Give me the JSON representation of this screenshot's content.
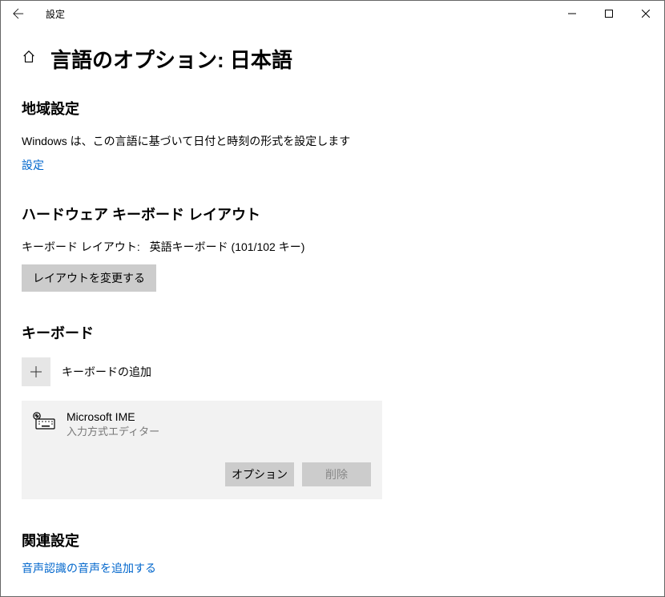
{
  "window": {
    "title": "設定"
  },
  "page": {
    "title": "言語のオプション: 日本語"
  },
  "region": {
    "heading": "地域設定",
    "description": "Windows は、この言語に基づいて日付と時刻の形式を設定します",
    "link": "設定"
  },
  "hardware_keyboard": {
    "heading": "ハードウェア キーボード レイアウト",
    "label": "キーボード レイアウト:",
    "value": "英語キーボード (101/102 キー)",
    "button": "レイアウトを変更する"
  },
  "keyboards": {
    "heading": "キーボード",
    "add_label": "キーボードの追加",
    "ime": {
      "name": "Microsoft IME",
      "sub": "入力方式エディター",
      "options_btn": "オプション",
      "delete_btn": "削除"
    }
  },
  "related": {
    "heading": "関連設定",
    "link": "音声認識の音声を追加する"
  }
}
